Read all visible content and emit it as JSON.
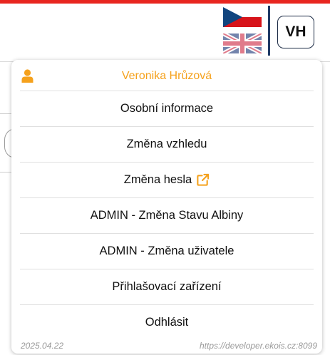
{
  "header": {
    "avatar_initials": "VH",
    "languages": [
      {
        "code": "cs",
        "icon": "czech-flag-icon",
        "active": true
      },
      {
        "code": "en",
        "icon": "uk-flag-icon",
        "active": false
      }
    ],
    "accent_color": "#e8261f"
  },
  "menu": {
    "user_name": "Veronika Hrůzová",
    "user_icon": "user-icon",
    "user_color": "#f5a11c",
    "items": [
      {
        "label": "Osobní informace"
      },
      {
        "label": "Změna vzhledu"
      },
      {
        "label": "Změna hesla",
        "icon": "external-link-icon"
      },
      {
        "label": "ADMIN - Změna Stavu Albiny"
      },
      {
        "label": "ADMIN - Změna uživatele"
      },
      {
        "label": "Přihlašovací zařízení"
      },
      {
        "label": "Odhlásit"
      }
    ],
    "footer": {
      "version": "2025.04.22",
      "url": "https://developer.ekois.cz:8099"
    }
  }
}
